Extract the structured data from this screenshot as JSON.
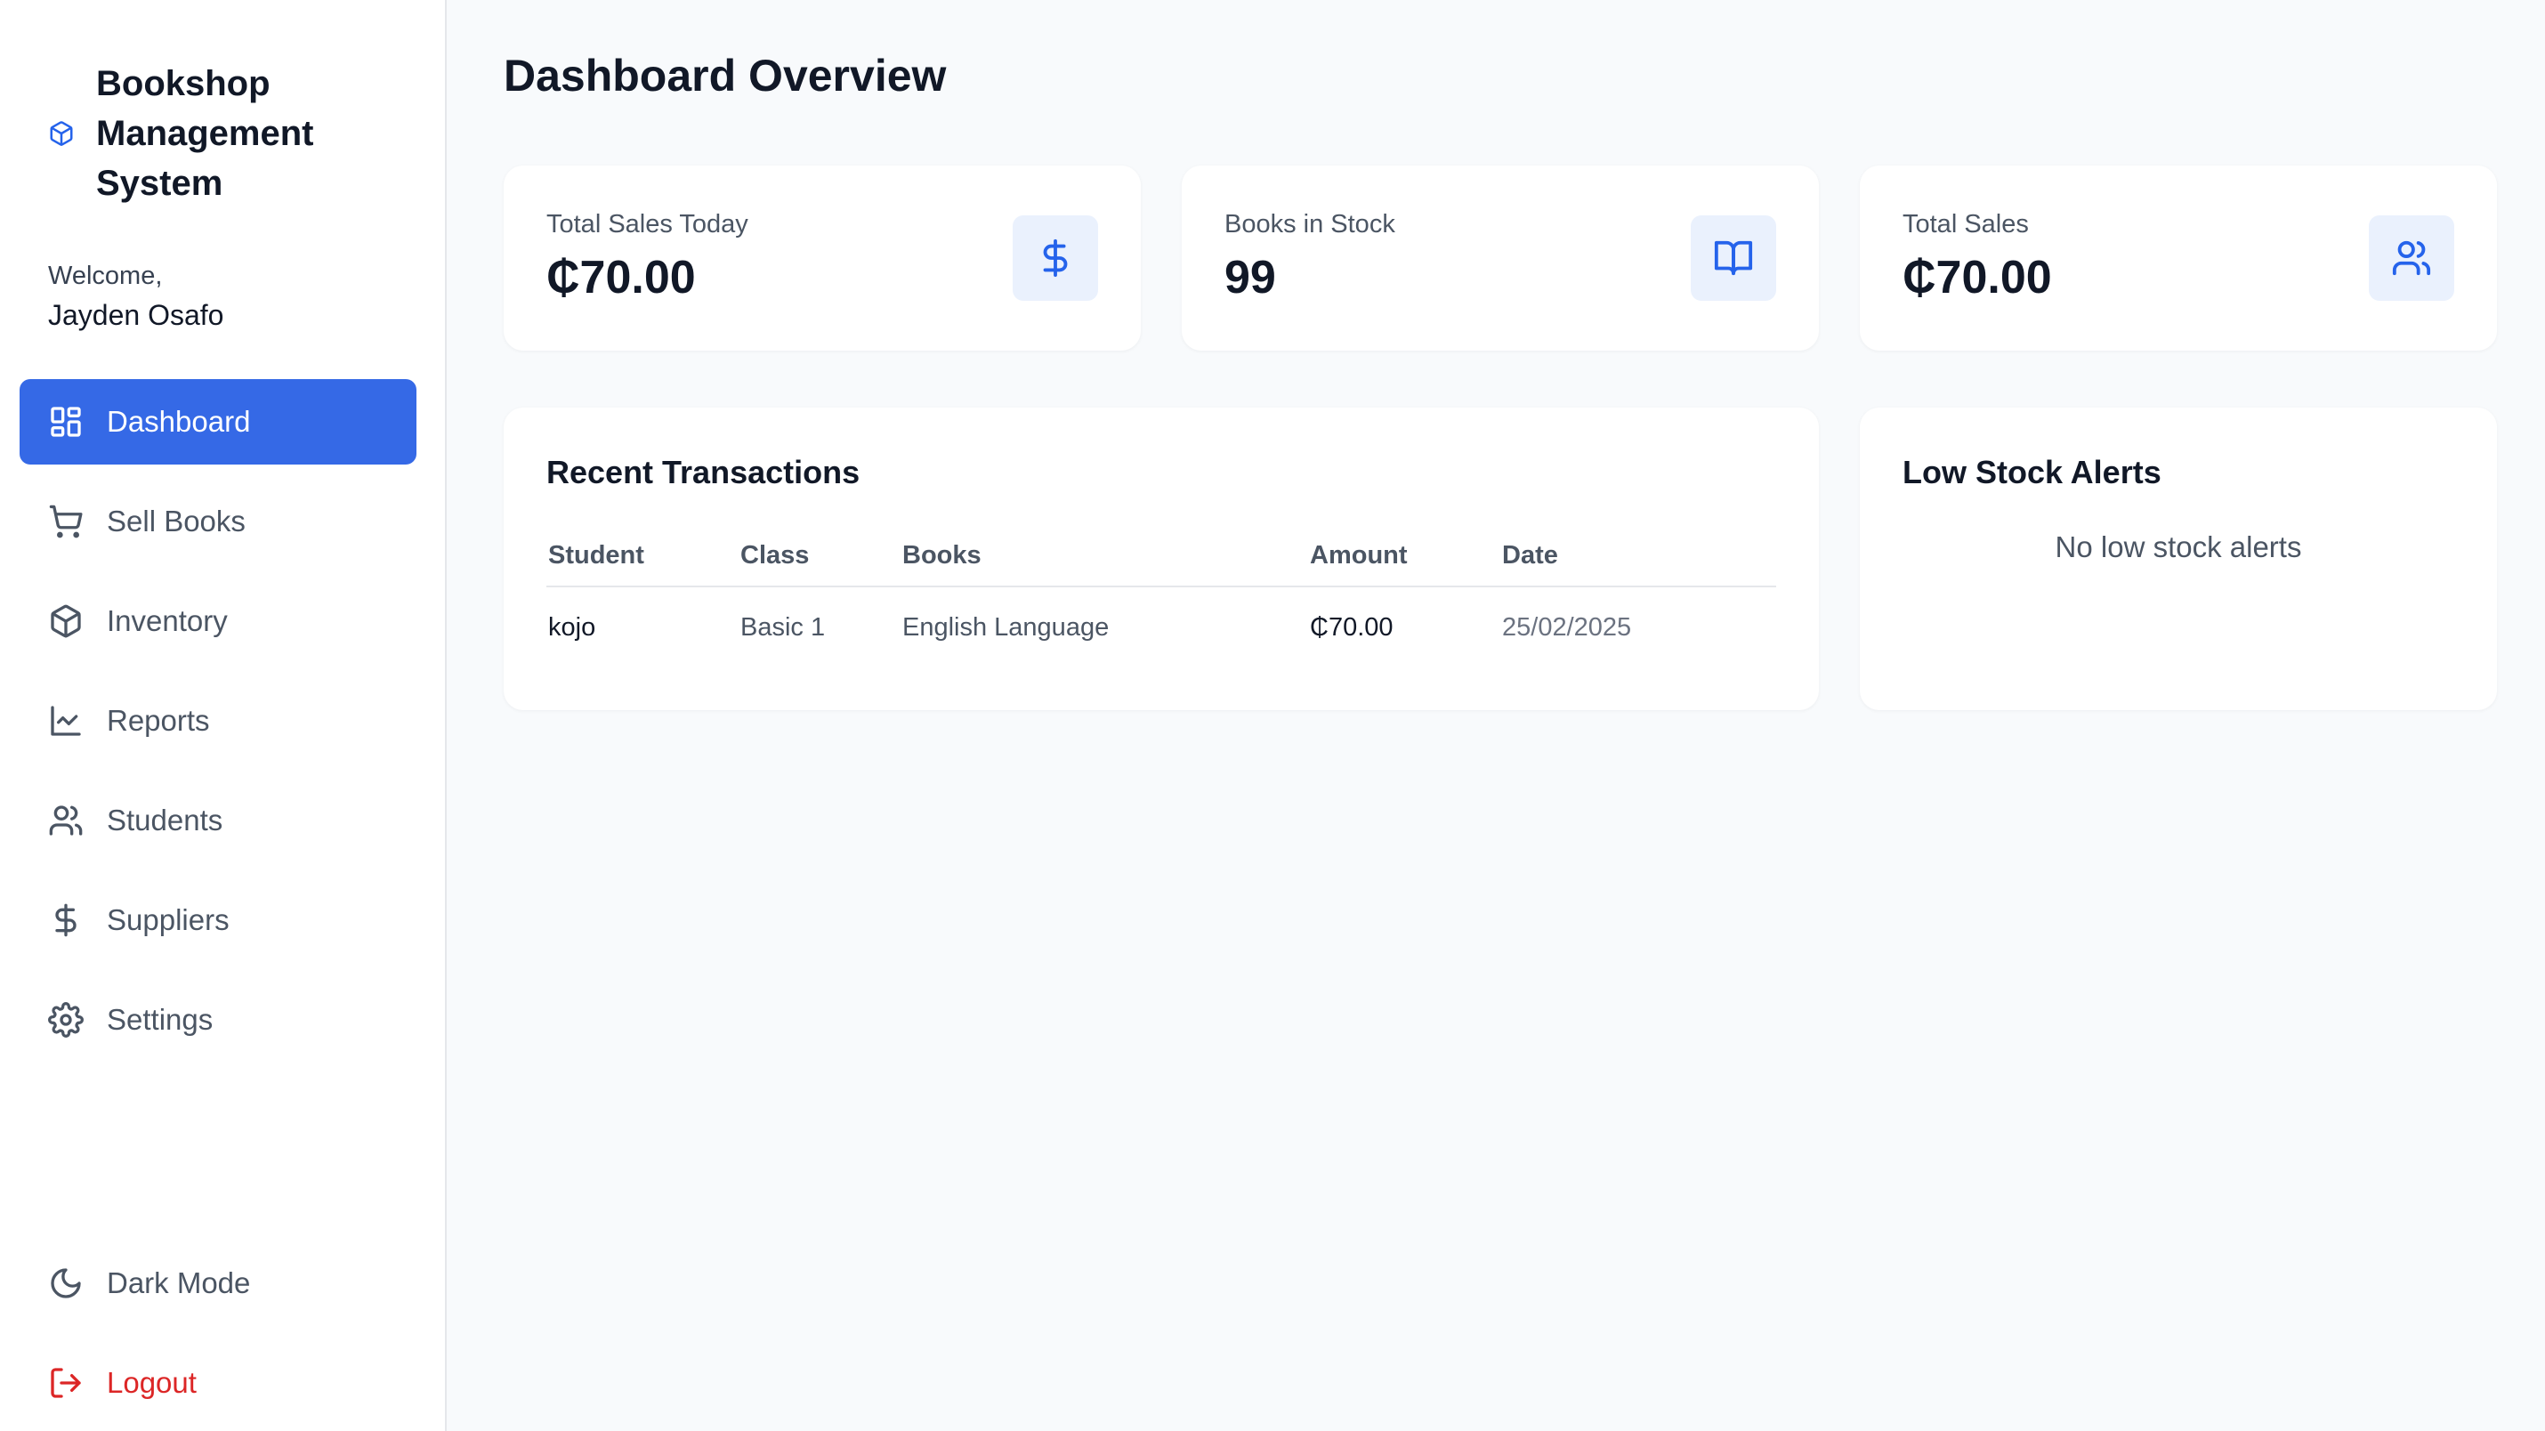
{
  "app": {
    "title": "Bookshop Management System",
    "welcome_label": "Welcome,",
    "user_name": "Jayden Osafo"
  },
  "sidebar": {
    "items": [
      {
        "label": "Dashboard",
        "icon": "dashboard-grid-icon",
        "active": true
      },
      {
        "label": "Sell Books",
        "icon": "shopping-cart-icon"
      },
      {
        "label": "Inventory",
        "icon": "package-icon"
      },
      {
        "label": "Reports",
        "icon": "line-chart-icon"
      },
      {
        "label": "Students",
        "icon": "users-icon"
      },
      {
        "label": "Suppliers",
        "icon": "dollar-icon"
      },
      {
        "label": "Settings",
        "icon": "gear-icon"
      }
    ],
    "bottom": [
      {
        "label": "Dark Mode",
        "icon": "moon-icon"
      },
      {
        "label": "Logout",
        "icon": "logout-icon"
      }
    ]
  },
  "main": {
    "title": "Dashboard Overview",
    "stats": [
      {
        "label": "Total Sales Today",
        "value": "₵70.00",
        "icon": "dollar-icon"
      },
      {
        "label": "Books in Stock",
        "value": "99",
        "icon": "book-open-icon"
      },
      {
        "label": "Total Sales",
        "value": "₵70.00",
        "icon": "users-icon"
      }
    ],
    "transactions": {
      "title": "Recent Transactions",
      "columns": [
        "Student",
        "Class",
        "Books",
        "Amount",
        "Date"
      ],
      "rows": [
        {
          "student": "kojo",
          "class": "Basic 1",
          "books": "English Language",
          "amount": "₵70.00",
          "date": "25/02/2025"
        }
      ]
    },
    "alerts": {
      "title": "Low Stock Alerts",
      "empty": "No low stock alerts"
    }
  },
  "colors": {
    "accent": "#3569e6",
    "danger": "#dc2626",
    "background": "#f8fafc",
    "icon_bg": "#eaf1fd"
  }
}
